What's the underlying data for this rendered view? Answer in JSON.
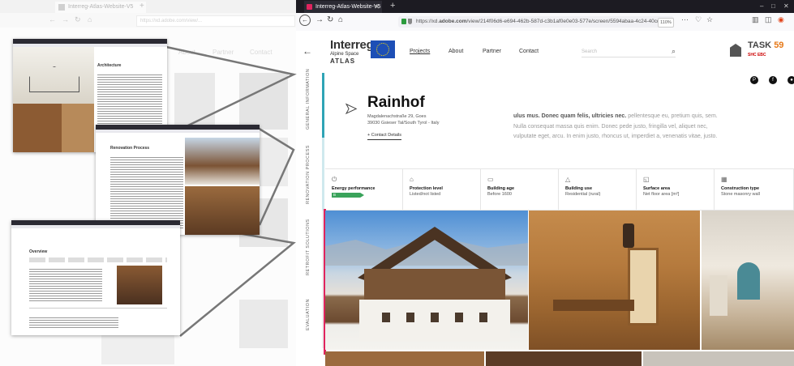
{
  "background_window": {
    "tab_title": "Interreg-Atlas-Website-V5",
    "url": "https://xd.adobe.com/view/...",
    "menu": [
      "Projects",
      "About",
      "Partner",
      "Contact"
    ]
  },
  "browser": {
    "tab_title": "Interreg-Atlas-Website-V5",
    "new_tab": "+",
    "window_controls": [
      "–",
      "□",
      "✕"
    ],
    "url_prefix": "https://xd.",
    "url_domain": "adobe.com",
    "url_rest": "/view/214f06d6-e694-462b-587d-c3b1af0e0e03-577e/screen/5594abaa-4c24-40cd",
    "zoom": "110%",
    "nav_icons": [
      "back-arrow-icon",
      "forward-arrow-icon",
      "reload-icon",
      "home-icon"
    ]
  },
  "site": {
    "logo_line1": "Interreg",
    "logo_line2": "Alpine Space",
    "logo_line3": "ATLAS",
    "nav": [
      "Projects",
      "About",
      "Partner",
      "Contact"
    ],
    "search_placeholder": "Search",
    "partner_logo_title": "TASK ",
    "partner_logo_number": "59",
    "partner_logo_sub": "SHC  EBC",
    "side_sections": [
      "GENERAL INFORMATION",
      "RENOVATION PROCESS",
      "RETROFIT SOLUTIONS",
      "EVALUATION"
    ],
    "social_icons": [
      "pinterest-icon",
      "facebook-icon",
      "share-icon"
    ]
  },
  "building": {
    "name": "Rainhof",
    "address_line1": "Magdalenachstraße 29, Goes",
    "address_line2": "39030 Gsieser Tal/South Tyrol - Italy",
    "contact_label": "+ Contact Details",
    "description_bold": "ulus mus. Donec quam felis, ultricies nec.",
    "description_rest": " pellentesque eu, pretium quis, sem. Nulla consequat massa quis enim. Donec pede justo, fringilla vel, aliquet nec, vulputate eget, arcu. In enim justo, rhoncus ut, imperdiet a, venenatis vitae, justo."
  },
  "attributes": [
    {
      "icon": "energy-icon",
      "title": "Energy performance",
      "value": "",
      "badge": "B",
      "badge_color": "#3aa35b"
    },
    {
      "icon": "monument-icon",
      "title": "Protection level",
      "value": "Listed/not listed"
    },
    {
      "icon": "calendar-icon",
      "title": "Building age",
      "value": "Before 1600"
    },
    {
      "icon": "house-icon",
      "title": "Building use",
      "value": "Residential (rural)"
    },
    {
      "icon": "area-icon",
      "title": "Surface area",
      "value": "Net floor area [m²]"
    },
    {
      "icon": "wall-icon",
      "title": "Construction type",
      "value": "Stone masonry wall"
    }
  ],
  "overlays": [
    {
      "title": "Architecture"
    },
    {
      "title": "Renovation Process"
    },
    {
      "title": "Overview"
    }
  ],
  "colors": {
    "accent_red": "#e0245e",
    "accent_teal": "#2fa4b6",
    "energy_green": "#3aa35b",
    "task_orange": "#e67817"
  }
}
